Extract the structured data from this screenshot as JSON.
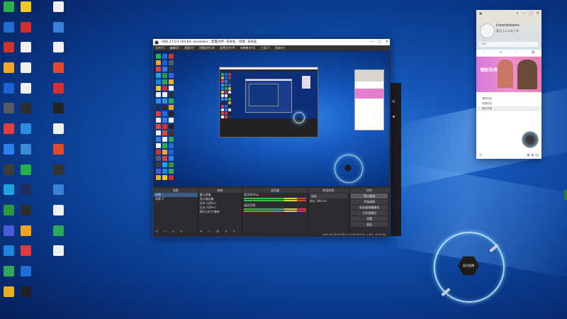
{
  "desktop": {
    "icons_col1": [
      {
        "label": "",
        "color": "#2ab24a"
      },
      {
        "label": "",
        "color": "#1f6fd1"
      },
      {
        "label": "",
        "color": "#d0342c"
      },
      {
        "label": "",
        "color": "#f5a623"
      },
      {
        "label": "",
        "color": "#1c62d6"
      },
      {
        "label": "",
        "color": "#555b66"
      },
      {
        "label": "",
        "color": "#e33f3f"
      },
      {
        "label": "",
        "color": "#2f80ed"
      },
      {
        "label": "",
        "color": "#3c3c3c"
      },
      {
        "label": "",
        "color": "#1ea3e0"
      },
      {
        "label": "",
        "color": "#2b9a3e"
      },
      {
        "label": "",
        "color": "#4a5bd8"
      },
      {
        "label": "",
        "color": "#1b86de"
      },
      {
        "label": "",
        "color": "#2fa85b"
      },
      {
        "label": "",
        "color": "#e8b020"
      }
    ],
    "icons_col2": [
      {
        "label": "",
        "color": "#f3c623"
      },
      {
        "label": "",
        "color": "#d02e2e"
      },
      {
        "label": "",
        "color": "#f0f0f0"
      },
      {
        "label": "",
        "color": "#f0f0f0"
      },
      {
        "label": "",
        "color": "#f0f0f0"
      },
      {
        "label": "",
        "color": "#2e2e2e"
      },
      {
        "label": "",
        "color": "#2d8be0"
      },
      {
        "label": "",
        "color": "#3c8bd8"
      },
      {
        "label": "",
        "color": "#22b04c"
      },
      {
        "label": "",
        "color": "#1d2e5a"
      },
      {
        "label": "",
        "color": "#2d2d2d"
      },
      {
        "label": "",
        "color": "#f4a21e"
      },
      {
        "label": "",
        "color": "#e03a3a"
      },
      {
        "label": "",
        "color": "#1d6fd6"
      },
      {
        "label": "",
        "color": "#222222"
      }
    ],
    "icons_col3": [
      {
        "label": "",
        "color": "#f0f0f0"
      },
      {
        "label": "",
        "color": "#3a7fd8"
      },
      {
        "label": "",
        "color": "#f0f0f0"
      },
      {
        "label": "",
        "color": "#e34a2e"
      },
      {
        "label": "",
        "color": "#d83030"
      },
      {
        "label": "",
        "color": "#222"
      },
      {
        "label": "",
        "color": "#f0f0f0"
      },
      {
        "label": "",
        "color": "#e24a2a"
      },
      {
        "label": "",
        "color": "#333"
      },
      {
        "label": "",
        "color": "#3a7fd8"
      },
      {
        "label": "",
        "color": "#f0f0f0"
      },
      {
        "label": "",
        "color": "#2ea85b"
      },
      {
        "label": "",
        "color": "#f0f0f0"
      }
    ]
  },
  "obs": {
    "title": "OBS 27.0.1 (64-bit, windows) - 配置文件: 未命名 - 场景: 未命名",
    "menu": [
      "文件(F)",
      "编辑(E)",
      "视图(V)",
      "停靠部件(D)",
      "配置文件(P)",
      "场景集合(S)",
      "工具(T)",
      "帮助(H)"
    ],
    "source_toolbar": [
      "属性",
      "滤镜"
    ],
    "docks": {
      "scenes": {
        "header": "场景",
        "items": [
          "场景",
          "场景 2"
        ]
      },
      "sources": {
        "header": "来源",
        "items": [
          "窗口采集",
          "显示器采集",
          "文本 (GDI+)",
          "文本 (GDI+)",
          "图片幻灯片放映"
        ]
      },
      "mixer": {
        "header": "混音器",
        "channels": [
          "麦克风/Aux",
          "桌面音频"
        ]
      },
      "transitions": {
        "header": "转场特效",
        "type": "淡出",
        "duration_label": "时长",
        "duration": "300 ms"
      },
      "controls": {
        "header": "控件",
        "buttons": [
          "停止推流",
          "开始录制",
          "启动虚拟摄像机",
          "工作室模式",
          "设置",
          "退出"
        ]
      }
    },
    "status": "LIVE: 00:00:00  REC: 00:00:00  CPU: 1.8%, 30.00 fps"
  },
  "chat": {
    "user_name": "Lnrondreams",
    "signature": "看这儿么么哒了呀",
    "search_placeholder": "搜索",
    "banner_text": "精彩世界",
    "list_items": [
      "我的好友",
      "同事好友",
      "朋友分组"
    ],
    "controls": [
      "∨",
      "—",
      "□",
      "✕"
    ]
  },
  "overlay": {
    "big_ring_label": "面对直播"
  }
}
